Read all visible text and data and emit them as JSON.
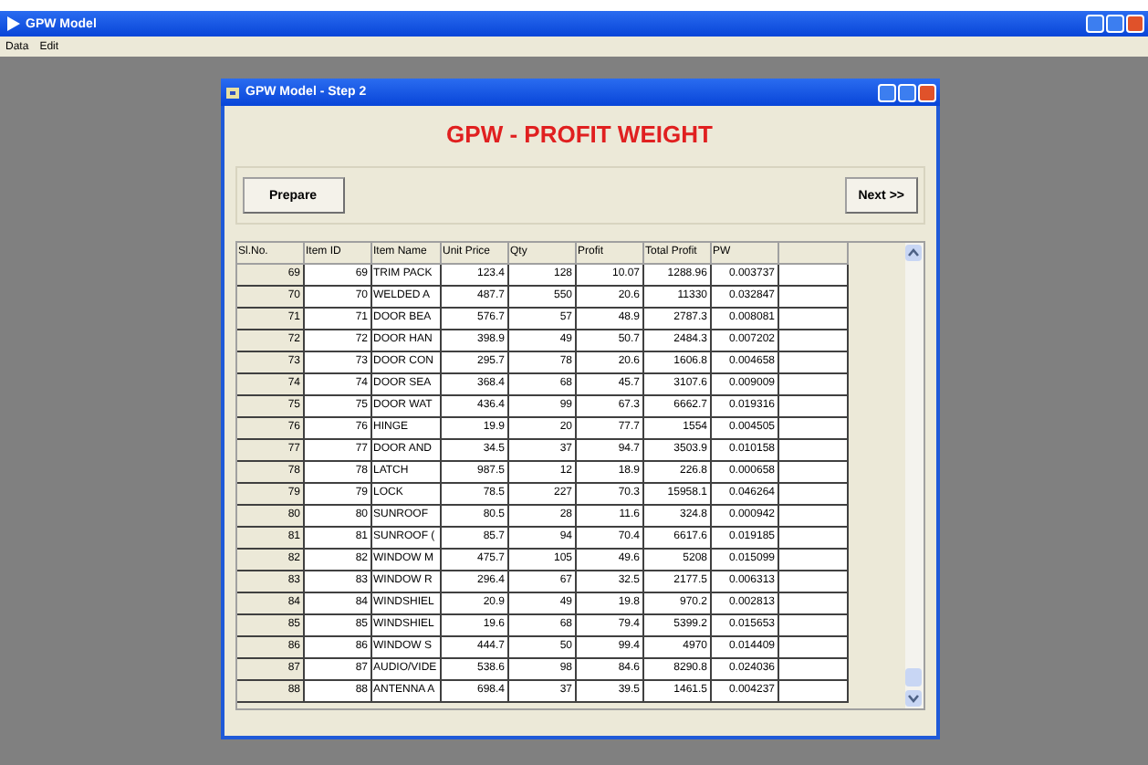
{
  "app_window": {
    "title": "GPW Model"
  },
  "menu": [
    "Data",
    "Edit"
  ],
  "dialog": {
    "title": "GPW Model - Step 2",
    "heading": "GPW - PROFIT WEIGHT",
    "buttons": {
      "prepare": "Prepare",
      "next": "Next >>"
    }
  },
  "table": {
    "columns": [
      "Sl.No.",
      "Item ID",
      "Item Name",
      "Unit Price",
      "Qty",
      "Profit",
      "Total Profit",
      "PW"
    ],
    "rows": [
      [
        "69",
        "69",
        "TRIM PACK",
        "123.4",
        "128",
        "10.07",
        "1288.96",
        "0.003737"
      ],
      [
        "70",
        "70",
        "WELDED A",
        "487.7",
        "550",
        "20.6",
        "11330",
        "0.032847"
      ],
      [
        "71",
        "71",
        "DOOR BEA",
        "576.7",
        "57",
        "48.9",
        "2787.3",
        "0.008081"
      ],
      [
        "72",
        "72",
        "DOOR HAN",
        "398.9",
        "49",
        "50.7",
        "2484.3",
        "0.007202"
      ],
      [
        "73",
        "73",
        "DOOR CON",
        "295.7",
        "78",
        "20.6",
        "1606.8",
        "0.004658"
      ],
      [
        "74",
        "74",
        "DOOR SEA",
        "368.4",
        "68",
        "45.7",
        "3107.6",
        "0.009009"
      ],
      [
        "75",
        "75",
        "DOOR WAT",
        "436.4",
        "99",
        "67.3",
        "6662.7",
        "0.019316"
      ],
      [
        "76",
        "76",
        "HINGE",
        "19.9",
        "20",
        "77.7",
        "1554",
        "0.004505"
      ],
      [
        "77",
        "77",
        "DOOR AND",
        "34.5",
        "37",
        "94.7",
        "3503.9",
        "0.010158"
      ],
      [
        "78",
        "78",
        "LATCH",
        "987.5",
        "12",
        "18.9",
        "226.8",
        "0.000658"
      ],
      [
        "79",
        "79",
        "LOCK",
        "78.5",
        "227",
        "70.3",
        "15958.1",
        "0.046264"
      ],
      [
        "80",
        "80",
        "SUNROOF",
        "80.5",
        "28",
        "11.6",
        "324.8",
        "0.000942"
      ],
      [
        "81",
        "81",
        "SUNROOF (",
        "85.7",
        "94",
        "70.4",
        "6617.6",
        "0.019185"
      ],
      [
        "82",
        "82",
        "WINDOW M",
        "475.7",
        "105",
        "49.6",
        "5208",
        "0.015099"
      ],
      [
        "83",
        "83",
        "WINDOW R",
        "296.4",
        "67",
        "32.5",
        "2177.5",
        "0.006313"
      ],
      [
        "84",
        "84",
        "WINDSHIEL",
        "20.9",
        "49",
        "19.8",
        "970.2",
        "0.002813"
      ],
      [
        "85",
        "85",
        "WINDSHIEL",
        "19.6",
        "68",
        "79.4",
        "5399.2",
        "0.015653"
      ],
      [
        "86",
        "86",
        "WINDOW S",
        "444.7",
        "50",
        "99.4",
        "4970",
        "0.014409"
      ],
      [
        "87",
        "87",
        "AUDIO/VIDE",
        "538.6",
        "98",
        "84.6",
        "8290.8",
        "0.024036"
      ],
      [
        "88",
        "88",
        "ANTENNA A",
        "698.4",
        "37",
        "39.5",
        "1461.5",
        "0.004237"
      ]
    ]
  }
}
